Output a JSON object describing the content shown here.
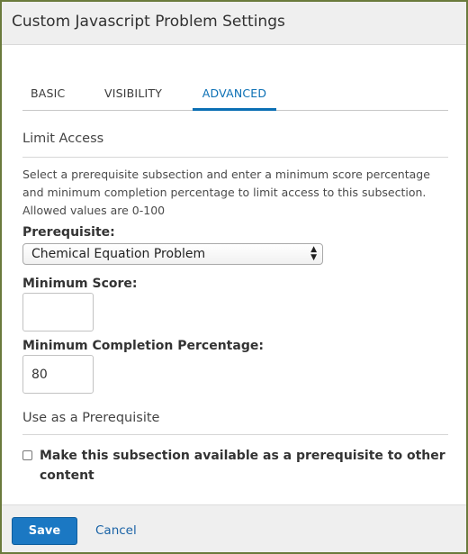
{
  "modal": {
    "title": "Custom Javascript Problem Settings"
  },
  "tabs": [
    {
      "label": "BASIC",
      "active": false
    },
    {
      "label": "VISIBILITY",
      "active": false
    },
    {
      "label": "ADVANCED",
      "active": true
    }
  ],
  "limit_access": {
    "heading": "Limit Access",
    "description": "Select a prerequisite subsection and enter a minimum score percentage and minimum completion percentage to limit access to this subsection. Allowed values are 0-100",
    "prerequisite_label": "Prerequisite:",
    "prerequisite_selected": "Chemical Equation Problem",
    "min_score_label": "Minimum Score:",
    "min_score_value": "",
    "min_completion_label": "Minimum Completion Percentage:",
    "min_completion_value": "80"
  },
  "prerequisite_section": {
    "heading": "Use as a Prerequisite",
    "checkbox_label": "Make this subsection available as a prerequisite to other content",
    "checked": false
  },
  "footer": {
    "save_label": "Save",
    "cancel_label": "Cancel"
  },
  "colors": {
    "accent": "#0a6fb4",
    "save_button": "#1b78c3",
    "frame_border": "#6a7a3c",
    "header_bg": "#efefef"
  },
  "icons": {
    "select_arrows": "select-arrows-icon"
  }
}
